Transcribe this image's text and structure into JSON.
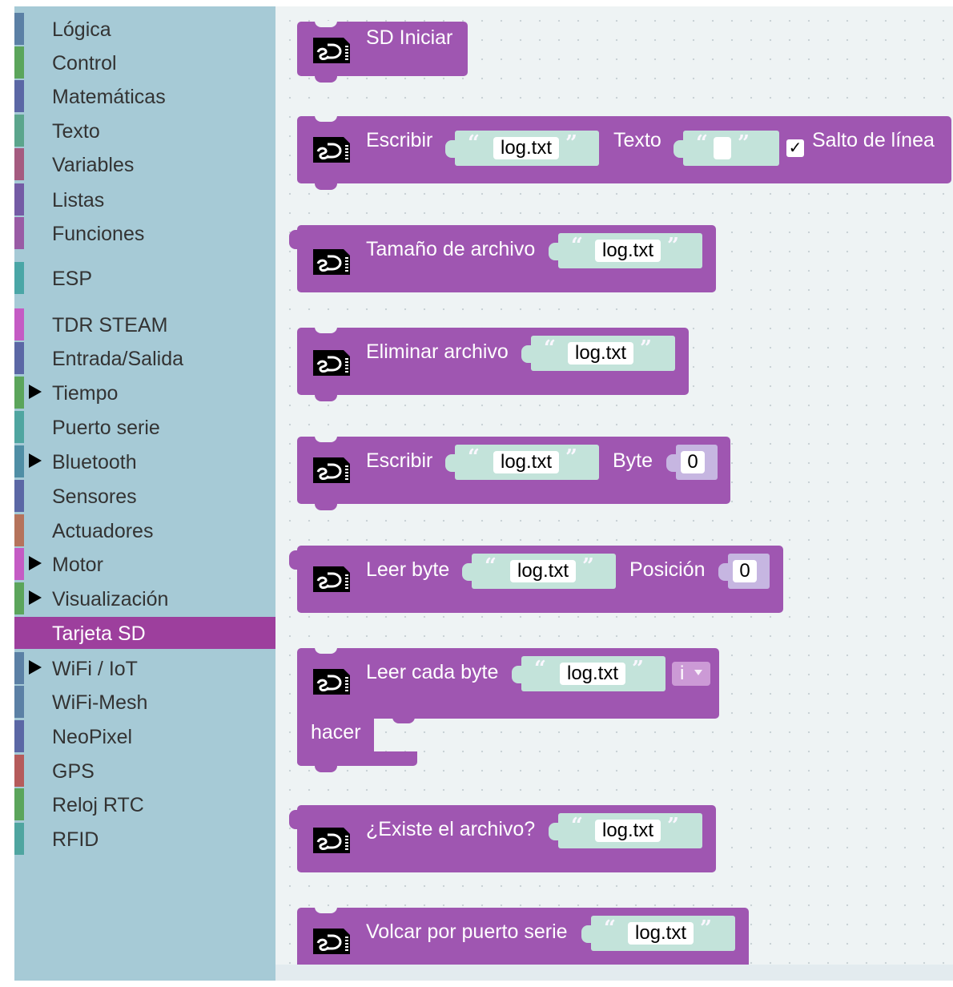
{
  "toolbox": {
    "categories": [
      {
        "label": "Lógica",
        "color": "#5b80a5",
        "expandable": false
      },
      {
        "label": "Control",
        "color": "#5ba55b",
        "expandable": false
      },
      {
        "label": "Matemáticas",
        "color": "#5b67a5",
        "expandable": false
      },
      {
        "label": "Texto",
        "color": "#5ba58c",
        "expandable": false
      },
      {
        "label": "Variables",
        "color": "#a55b80",
        "expandable": false
      },
      {
        "label": "Listas",
        "color": "#745ba5",
        "expandable": false
      },
      {
        "label": "Funciones",
        "color": "#995ba5",
        "expandable": false
      },
      {
        "label": "ESP",
        "color": "#4aa6a6",
        "expandable": false
      },
      {
        "label": "TDR STEAM",
        "color": "#c45bc4",
        "expandable": false
      },
      {
        "label": "Entrada/Salida",
        "color": "#5b67a5",
        "expandable": false
      },
      {
        "label": "Tiempo",
        "color": "#5ba55b",
        "expandable": true
      },
      {
        "label": "Puerto serie",
        "color": "#4fa5a0",
        "expandable": false
      },
      {
        "label": "Bluetooth",
        "color": "#4f8ea5",
        "expandable": true
      },
      {
        "label": "Sensores",
        "color": "#5b67a5",
        "expandable": false
      },
      {
        "label": "Actuadores",
        "color": "#b5735b",
        "expandable": false
      },
      {
        "label": "Motor",
        "color": "#c45bc4",
        "expandable": true
      },
      {
        "label": "Visualización",
        "color": "#5ba55b",
        "expandable": true
      },
      {
        "label": "Tarjeta SD",
        "color": "#9d3f9d",
        "expandable": false,
        "selected": true
      },
      {
        "label": "WiFi / IoT",
        "color": "#5b80a5",
        "expandable": true
      },
      {
        "label": "WiFi-Mesh",
        "color": "#5b80a5",
        "expandable": false
      },
      {
        "label": "NeoPixel",
        "color": "#5b67a5",
        "expandable": false
      },
      {
        "label": "GPS",
        "color": "#b55b5b",
        "expandable": false
      },
      {
        "label": "Reloj RTC",
        "color": "#5ba55b",
        "expandable": false
      },
      {
        "label": "RFID",
        "color": "#4fa5a0",
        "expandable": false
      }
    ]
  },
  "blocks": {
    "sd_init": {
      "label": "SD Iniciar"
    },
    "sd_write": {
      "label": "Escribir",
      "file": "log.txt",
      "text_label": "Texto",
      "text_value": "",
      "checkbox_label": "Salto de línea",
      "checked": true
    },
    "sd_size": {
      "label": "Tamaño de archivo",
      "file": "log.txt"
    },
    "sd_delete": {
      "label": "Eliminar archivo",
      "file": "log.txt"
    },
    "sd_write_byte": {
      "label": "Escribir",
      "file": "log.txt",
      "byte_label": "Byte",
      "byte_value": "0"
    },
    "sd_read_byte": {
      "label": "Leer byte",
      "file": "log.txt",
      "pos_label": "Posición",
      "pos_value": "0"
    },
    "sd_each_byte": {
      "label": "Leer cada byte",
      "file": "log.txt",
      "var": "i",
      "do_label": "hacer"
    },
    "sd_exists": {
      "label": "¿Existe el archivo?",
      "file": "log.txt"
    },
    "sd_dump": {
      "label": "Volcar por puerto serie",
      "file": "log.txt"
    }
  },
  "glyphs": {
    "quote_open": "“",
    "quote_close": "”",
    "check": "✓"
  },
  "colors": {
    "block": "#9f56b1",
    "string_input": "#c3e3da",
    "number_input": "#c6b6e1",
    "toolbox_bg": "#a6cad6",
    "selected": "#9d3f9d"
  }
}
